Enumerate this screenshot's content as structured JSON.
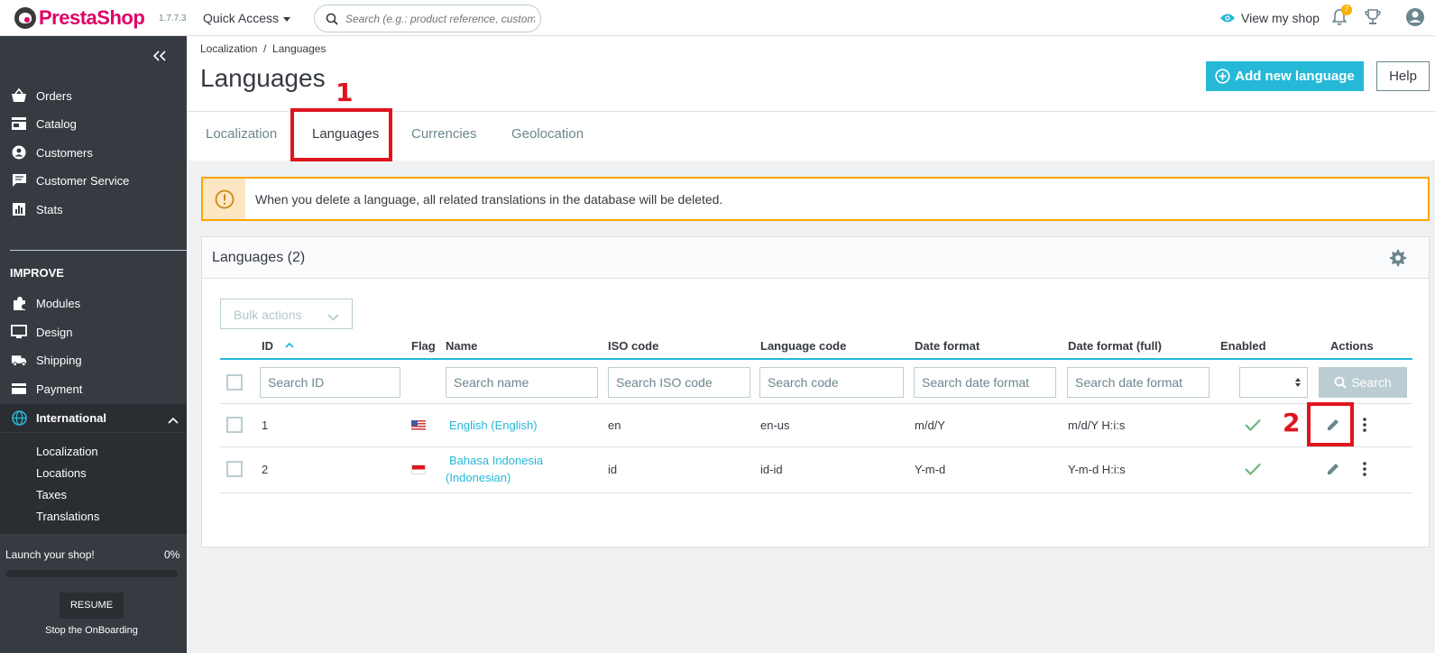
{
  "header": {
    "logo_text": "PrestaShop",
    "version": "1.7.7.3",
    "quick_access": "Quick Access",
    "search_placeholder": "Search (e.g.: product reference, customer name...)",
    "view_shop": "View my shop",
    "notifications_count": "7"
  },
  "sidebar": {
    "items": [
      {
        "label": "Orders",
        "icon": "basket-icon"
      },
      {
        "label": "Catalog",
        "icon": "store-icon"
      },
      {
        "label": "Customers",
        "icon": "account-circle-icon"
      },
      {
        "label": "Customer Service",
        "icon": "chat-icon"
      },
      {
        "label": "Stats",
        "icon": "bar-chart-icon"
      }
    ],
    "section_improve": "IMPROVE",
    "improve_items": [
      {
        "label": "Modules",
        "icon": "puzzle-icon"
      },
      {
        "label": "Design",
        "icon": "monitor-icon"
      },
      {
        "label": "Shipping",
        "icon": "truck-icon"
      },
      {
        "label": "Payment",
        "icon": "credit-card-icon"
      },
      {
        "label": "International",
        "icon": "globe-icon"
      }
    ],
    "international_sub": [
      "Localization",
      "Locations",
      "Taxes",
      "Translations"
    ],
    "launch_label": "Launch your shop!",
    "launch_percent": "0%",
    "launch_progress": 0,
    "resume_label": "RESUME",
    "stop_label": "Stop the OnBoarding"
  },
  "page": {
    "breadcrumb": "Localization  /  Languages",
    "title": "Languages",
    "add_button": "Add new language",
    "help_button": "Help",
    "tabs": [
      "Localization",
      "Languages",
      "Currencies",
      "Geolocation"
    ],
    "active_tab": "Languages"
  },
  "annotations": {
    "mark1": "1",
    "mark2": "2"
  },
  "alert": {
    "message": "When you delete a language, all related translations in the database will be deleted."
  },
  "card": {
    "title": "Languages (2)",
    "bulk_actions": "Bulk actions",
    "columns": [
      "ID",
      "Flag",
      "Name",
      "ISO code",
      "Language code",
      "Date format",
      "Date format (full)",
      "Enabled",
      "Actions"
    ],
    "filters": {
      "id": "Search ID",
      "name": "Search name",
      "iso": "Search ISO code",
      "code": "Search code",
      "date": "Search date format",
      "date_full": "Search date format"
    },
    "search_button": "Search",
    "rows": [
      {
        "id": "1",
        "name": "English (English)",
        "iso": "en",
        "code": "en-us",
        "date": "m/d/Y",
        "date_full": "m/d/Y H:i:s",
        "enabled": true
      },
      {
        "id": "2",
        "name_line1": "Bahasa Indonesia",
        "name_line2": "(Indonesian)",
        "iso": "id",
        "code": "id-id",
        "date": "Y-m-d",
        "date_full": "Y-m-d H:i:s",
        "enabled": true
      }
    ]
  },
  "colors": {
    "accent": "#25b9d7",
    "brand": "#df0067",
    "sidebar": "#363a41",
    "warning": "#ffa500",
    "highlight": "#e0141e"
  }
}
